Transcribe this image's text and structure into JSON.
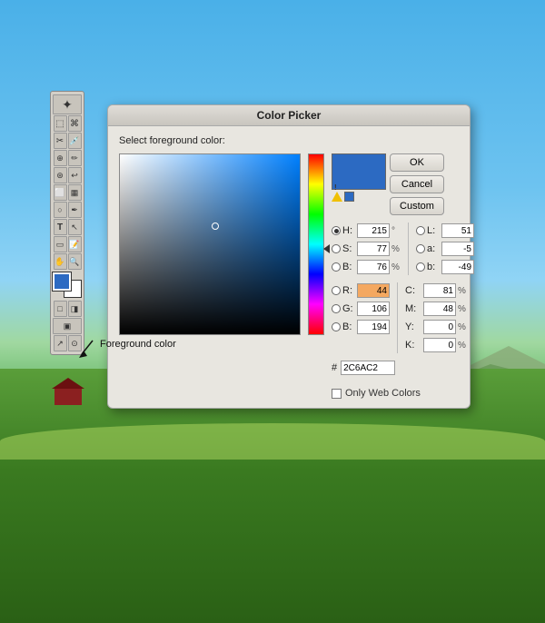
{
  "window": {
    "title": "Color Picker"
  },
  "dialog": {
    "title": "Color Picker",
    "label": "Select foreground color:",
    "ok_button": "OK",
    "cancel_button": "Cancel",
    "custom_button": "Custom",
    "only_web_colors": "Only Web Colors"
  },
  "color": {
    "hex": "2C6AC2",
    "h": "215",
    "s": "77",
    "b": "76",
    "r": "44",
    "g": "106",
    "r_b": "194",
    "l": "51",
    "a": "-5",
    "b_lab": "-49",
    "c": "81",
    "m": "48",
    "y": "0",
    "k": "0",
    "h_unit": "°",
    "percent": "%"
  },
  "toolbar": {
    "fg_color": "#2C6AC2",
    "bg_color": "#ffffff"
  },
  "annotation": {
    "label": "Foreground color"
  }
}
